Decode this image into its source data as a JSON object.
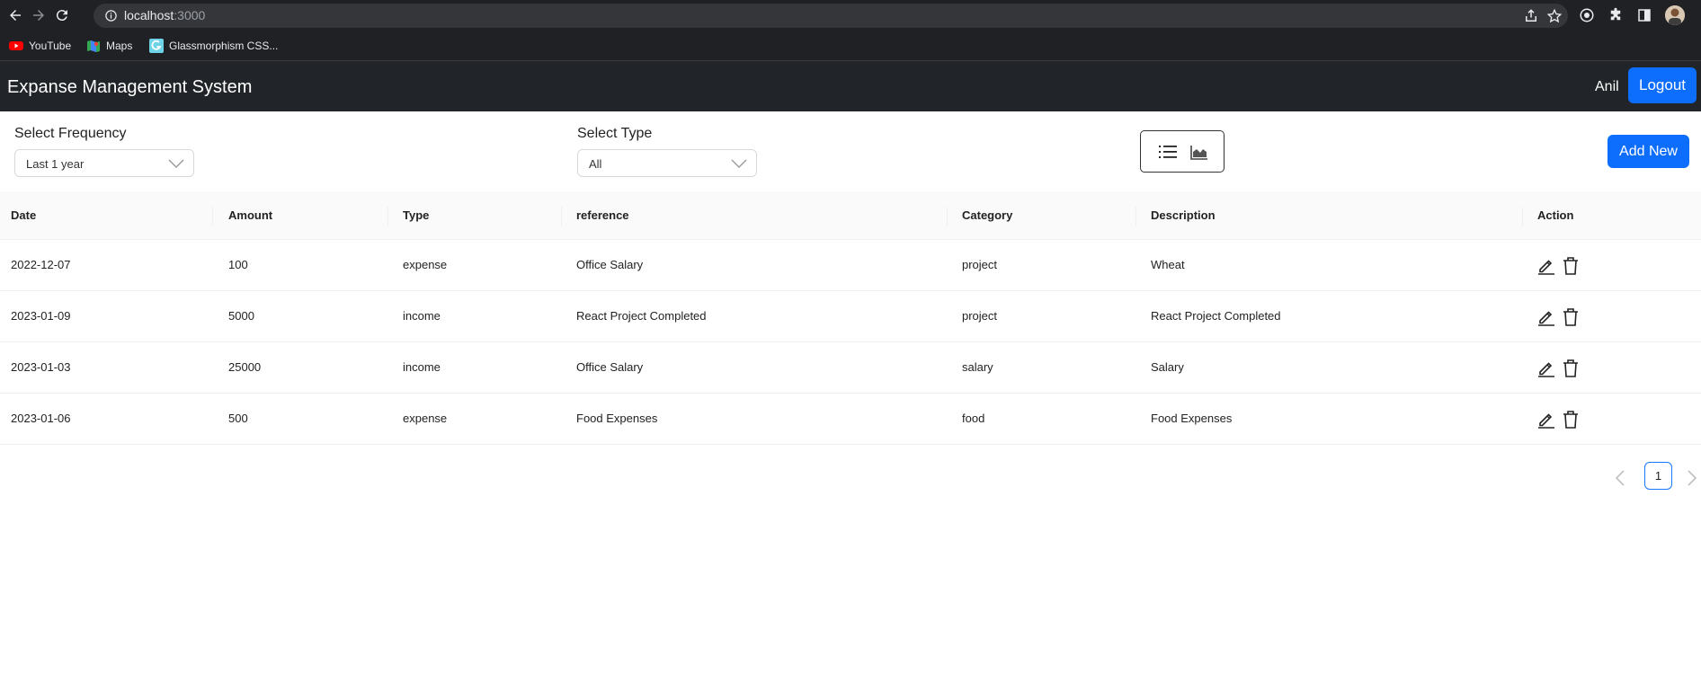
{
  "browser": {
    "url_host": "localhost",
    "url_port": ":3000",
    "bookmarks": [
      {
        "label": "YouTube",
        "icon": "youtube-icon"
      },
      {
        "label": "Maps",
        "icon": "maps-icon"
      },
      {
        "label": "Glassmorphism CSS...",
        "icon": "glassmorphism-icon"
      }
    ]
  },
  "navbar": {
    "brand": "Expanse Management System",
    "user": "Anil",
    "logout_label": "Logout"
  },
  "filters": {
    "frequency_label": "Select Frequency",
    "frequency_value": "Last 1 year",
    "type_label": "Select Type",
    "type_value": "All",
    "add_new_label": "Add New"
  },
  "table": {
    "columns": [
      "Date",
      "Amount",
      "Type",
      "reference",
      "Category",
      "Description",
      "Action"
    ],
    "rows": [
      {
        "date": "2022-12-07",
        "amount": "100",
        "type": "expense",
        "reference": "Office Salary",
        "category": "project",
        "description": "Wheat"
      },
      {
        "date": "2023-01-09",
        "amount": "5000",
        "type": "income",
        "reference": "React Project Completed",
        "category": "project",
        "description": "React Project Completed"
      },
      {
        "date": "2023-01-03",
        "amount": "25000",
        "type": "income",
        "reference": "Office Salary",
        "category": "salary",
        "description": "Salary"
      },
      {
        "date": "2023-01-06",
        "amount": "500",
        "type": "expense",
        "reference": "Food Expenses",
        "category": "food",
        "description": "Food Expenses"
      }
    ]
  },
  "pagination": {
    "current_page": "1"
  },
  "colors": {
    "primary": "#0d6efd",
    "navbar_bg": "#212529",
    "chrome_bg": "#202124",
    "pagination_border": "#1677ff"
  }
}
